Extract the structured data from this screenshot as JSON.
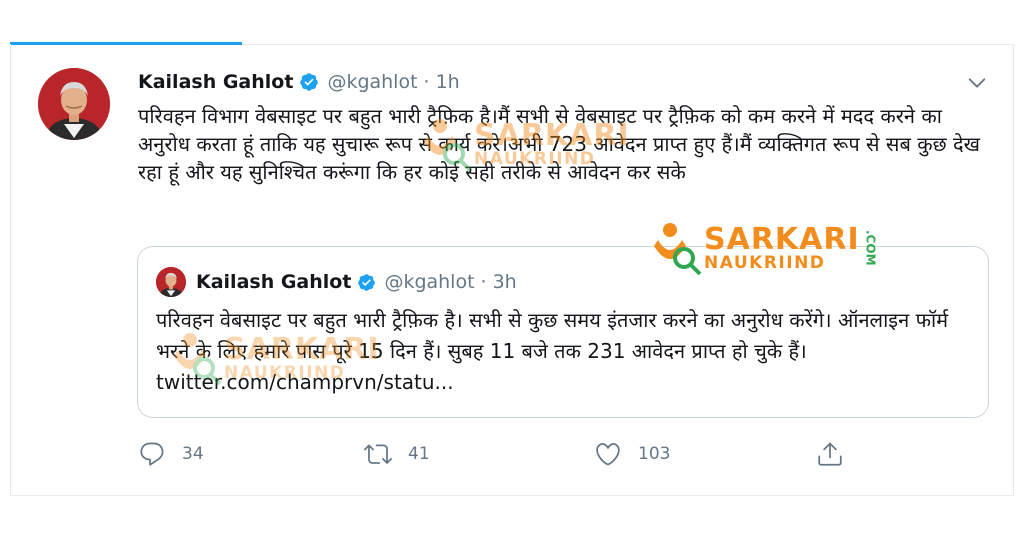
{
  "tweet": {
    "author_name": "Kailash Gahlot",
    "handle": "@kgahlot",
    "separator": "·",
    "time": "1h",
    "text": "परिवहन विभाग वेबसाइट पर बहुत भारी ट्रैफ़िक है।मैं सभी से वेबसाइट पर ट्रैफ़िक को कम करने में मदद करने का अनुरोध करता हूं ताकि यह सुचारू रूप से कार्य करे।अभी 723 आवेदन प्राप्त हुए हैं।मैं व्यक्तिगत रूप से सब कुछ देख रहा हूं और यह सुनिश्चित करूंगा कि हर कोई सही तरीके से आवेदन कर सके"
  },
  "quoted_tweet": {
    "author_name": "Kailash Gahlot",
    "handle": "@kgahlot",
    "separator": "·",
    "time": "3h",
    "text": "परिवहन वेबसाइट पर बहुत भारी ट्रैफ़िक है। सभी से कुछ समय इंतजार करने का अनुरोध करेंगे। ऑनलाइन फॉर्म भरने के लिए हमारे पास पूरे 15 दिन हैं। सुबह 11 बजे तक 231 आवेदन प्राप्त हो चुके हैं। twitter.com/champrvn/statu..."
  },
  "actions": {
    "replies": "34",
    "retweets": "41",
    "likes": "103"
  },
  "watermark": {
    "line1": "SARKARI",
    "line2": "NAUKRIIND",
    "suffix": ".COM"
  },
  "icons": {
    "verified": "verified-badge-icon",
    "caret": "chevron-down-icon",
    "reply": "reply-icon",
    "retweet": "retweet-icon",
    "like": "heart-icon",
    "share": "share-icon"
  },
  "colors": {
    "accent": "#1da1f2",
    "secondary_text": "#657786",
    "border": "#ccd6dd",
    "watermark_orange": "#f28c1c",
    "watermark_green": "#2fa84f"
  }
}
